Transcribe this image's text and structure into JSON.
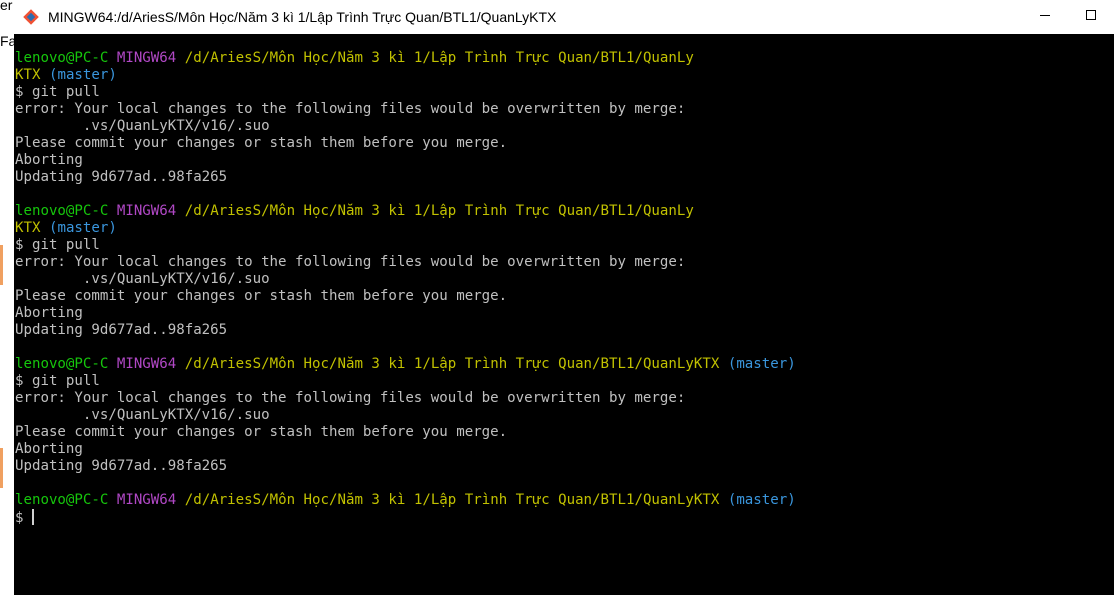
{
  "window": {
    "title": "MINGW64:/d/AriesS/Môn Học/Năm 3 kì 1/Lập Trình Trực Quan/BTL1/QuanLyKTX"
  },
  "background_window": {
    "line1": "er",
    "line2": "Fac"
  },
  "terminal": {
    "lines": [
      {
        "t": "prompt",
        "user": "lenovo@PC-C",
        "sys": "MINGW64",
        "path": "/d/AriesS/Môn Học/Năm 3 kì 1/Lập Trình Trực Quan/BTL1/QuanLy"
      },
      {
        "t": "wrap",
        "path": "KTX",
        "branch": "(master)"
      },
      {
        "t": "out",
        "text": "$ git pull"
      },
      {
        "t": "out",
        "text": "error: Your local changes to the following files would be overwritten by merge:"
      },
      {
        "t": "out",
        "text": "        .vs/QuanLyKTX/v16/.suo"
      },
      {
        "t": "out",
        "text": "Please commit your changes or stash them before you merge."
      },
      {
        "t": "out",
        "text": "Aborting"
      },
      {
        "t": "out",
        "text": "Updating 9d677ad..98fa265"
      },
      {
        "t": "out",
        "text": ""
      },
      {
        "t": "prompt",
        "user": "lenovo@PC-C",
        "sys": "MINGW64",
        "path": "/d/AriesS/Môn Học/Năm 3 kì 1/Lập Trình Trực Quan/BTL1/QuanLy"
      },
      {
        "t": "wrap",
        "path": "KTX",
        "branch": "(master)"
      },
      {
        "t": "out",
        "text": "$ git pull"
      },
      {
        "t": "out",
        "text": "error: Your local changes to the following files would be overwritten by merge:"
      },
      {
        "t": "out",
        "text": "        .vs/QuanLyKTX/v16/.suo"
      },
      {
        "t": "out",
        "text": "Please commit your changes or stash them before you merge."
      },
      {
        "t": "out",
        "text": "Aborting"
      },
      {
        "t": "out",
        "text": "Updating 9d677ad..98fa265"
      },
      {
        "t": "out",
        "text": ""
      },
      {
        "t": "prompt",
        "user": "lenovo@PC-C",
        "sys": "MINGW64",
        "path": "/d/AriesS/Môn Học/Năm 3 kì 1/Lập Trình Trực Quan/BTL1/QuanLyKTX",
        "branch": "(master)"
      },
      {
        "t": "out",
        "text": "$ git pull"
      },
      {
        "t": "out",
        "text": "error: Your local changes to the following files would be overwritten by merge:"
      },
      {
        "t": "out",
        "text": "        .vs/QuanLyKTX/v16/.suo"
      },
      {
        "t": "out",
        "text": "Please commit your changes or stash them before you merge."
      },
      {
        "t": "out",
        "text": "Aborting"
      },
      {
        "t": "out",
        "text": "Updating 9d677ad..98fa265"
      },
      {
        "t": "out",
        "text": ""
      },
      {
        "t": "prompt",
        "user": "lenovo@PC-C",
        "sys": "MINGW64",
        "path": "/d/AriesS/Môn Học/Năm 3 kì 1/Lập Trình Trực Quan/BTL1/QuanLyKTX",
        "branch": "(master)"
      },
      {
        "t": "input",
        "text": "$ "
      }
    ]
  },
  "colors": {
    "user": "#16c60c",
    "system": "#b148c6",
    "path": "#c1c100",
    "branch": "#3a96dd",
    "text": "#c0c0c0",
    "background": "#000000"
  },
  "icons": {
    "app": "git-bash-icon",
    "minimize": "minimize-icon",
    "maximize": "maximize-icon"
  }
}
